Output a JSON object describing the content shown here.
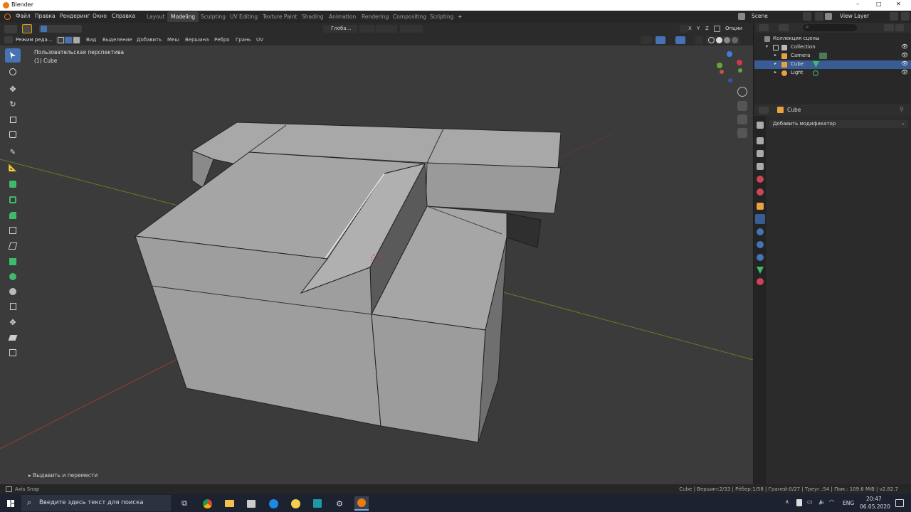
{
  "window": {
    "title": "Blender",
    "minimize": "–",
    "maximize": "□",
    "close": "✕"
  },
  "topbar": {
    "menus": [
      "Файл",
      "Правка",
      "Рендеринг",
      "Окно",
      "Справка"
    ],
    "workspaces": [
      "Layout",
      "Modeling",
      "Sculpting",
      "UV Editing",
      "Texture Paint",
      "Shading",
      "Animation",
      "Rendering",
      "Compositing",
      "Scripting"
    ],
    "add_tab": "+",
    "scene": "Scene",
    "view_layer": "View Layer"
  },
  "viewport_header": {
    "mode": "Режим реда...",
    "menus": [
      "Вид",
      "Выделение",
      "Добавить",
      "Меш",
      "Вершина",
      "Ребро",
      "Грань",
      "UV"
    ],
    "orientation": "Глоба...",
    "options": "Опции",
    "mirror": [
      "X",
      "Y",
      "Z"
    ]
  },
  "viewport": {
    "view_name": "Пользовательская перспектива",
    "object_name": "(1) Cube",
    "last_op": "Выдавить и перемести"
  },
  "outliner": {
    "title": "Коллекция сцены",
    "items": [
      {
        "label": "Collection"
      },
      {
        "label": "Camera"
      },
      {
        "label": "Cube"
      },
      {
        "label": "Light"
      }
    ]
  },
  "properties": {
    "object": "Cube",
    "add_modifier": "Добавить модификатор"
  },
  "statusbar": {
    "left": "Axis Snap",
    "right": "Cube | Вершин:2/33 | Рёбер:1/58 | Граней:0/27 | Треуг.:54 | Пам.: 109.6 MiB | v2.82.7"
  },
  "taskbar": {
    "search_placeholder": "Введите здесь текст для поиска",
    "lang": "ENG",
    "time": "20:47",
    "date": "06.05.2020"
  },
  "colors": {
    "accent": "#4772b3",
    "selected_row": "#3a5c94",
    "x_axis": "#b43b3b",
    "y_axis": "#7a8a2a"
  }
}
